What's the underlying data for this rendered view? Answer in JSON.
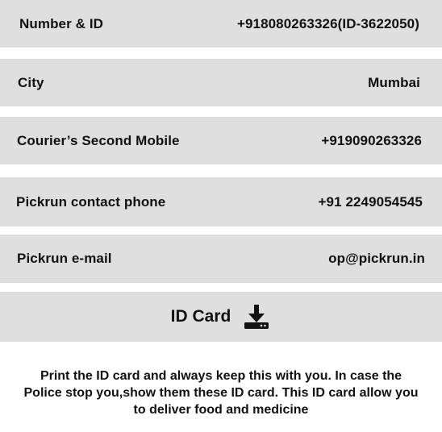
{
  "rows": [
    {
      "label": "Number & ID",
      "value": "+918080263326(ID-3622050)"
    },
    {
      "label": "City",
      "value": "Mumbai"
    },
    {
      "label": "Courier’s Second Mobile",
      "value": "+919090263326"
    },
    {
      "label": "Pickrun contact phone",
      "value": "+91 2249054545"
    },
    {
      "label": "Pickrun e-mail",
      "value": "op@pickrun.in"
    }
  ],
  "id_card": {
    "label": "ID Card",
    "icon": "download-icon"
  },
  "note": {
    "line1": "Print the ID card and always keep this with you. In case the",
    "line2": "Police stop you,show them these ID card. This ID card allow you",
    "line3": "to deliver food and medicine"
  }
}
